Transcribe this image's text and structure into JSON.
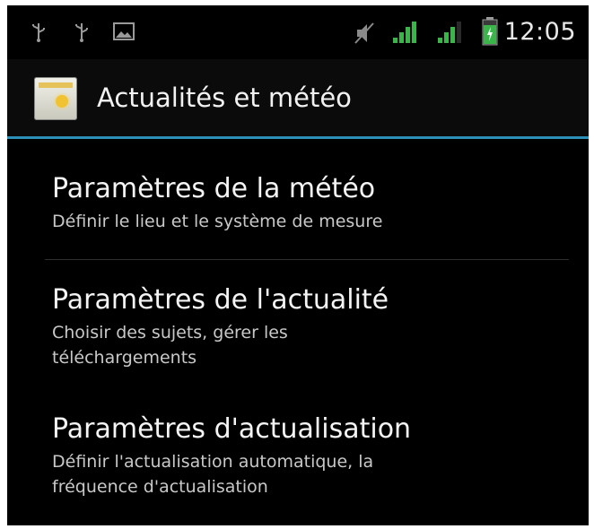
{
  "status_bar": {
    "time": "12:05",
    "icons": [
      "usb-icon",
      "usb-icon",
      "image-icon",
      "mute-icon",
      "signal-icon",
      "signal-icon",
      "battery-icon"
    ]
  },
  "action_bar": {
    "title": "Actualités et météo",
    "app_icon": "news-weather-icon",
    "accent_color": "#2b8fb8"
  },
  "settings": [
    {
      "title": "Paramètres de la météo",
      "subtitle": [
        "Définir le lieu et le système de mesure"
      ]
    },
    {
      "title": "Paramètres de l'actualité",
      "subtitle": [
        "Choisir des sujets, gérer les",
        "téléchargements"
      ]
    },
    {
      "title": "Paramètres d'actualisation",
      "subtitle": [
        "Définir l'actualisation automatique, la",
        "fréquence d'actualisation"
      ]
    }
  ]
}
